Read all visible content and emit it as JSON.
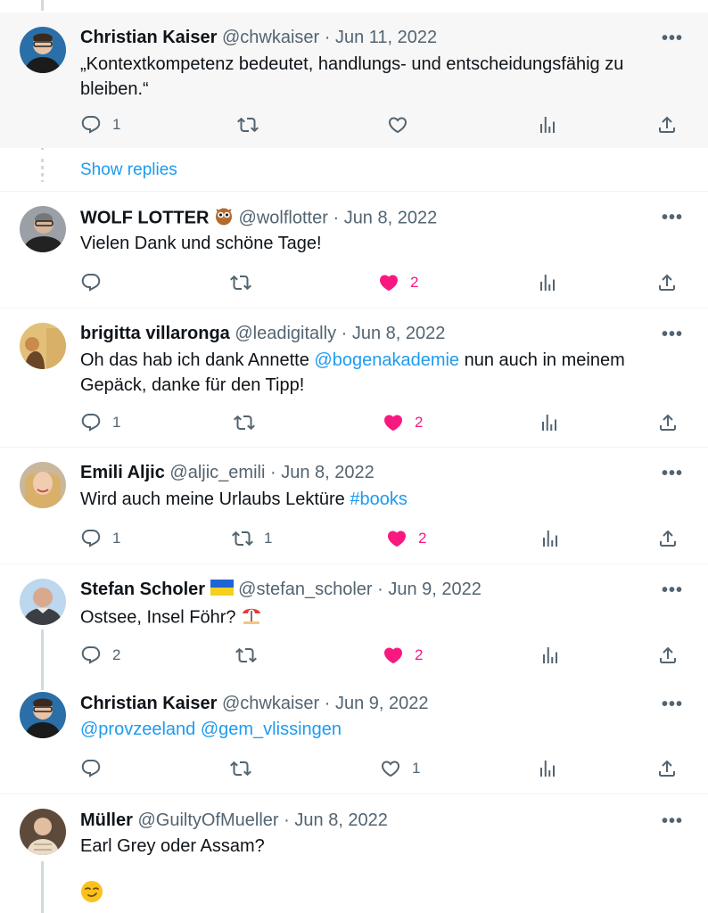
{
  "tweets": [
    {
      "name": "Christian Kaiser",
      "handle": "@chwkaiser",
      "date": "Jun 11, 2022",
      "text": "„Kontextkompetenz bedeutet, handlungs- und entscheidungsfähig zu bleiben.“",
      "replies": "1",
      "retweets": "",
      "likes": "",
      "liked": false
    },
    {
      "name": "WOLF LOTTER",
      "handle": "@wolflotter",
      "date": "Jun 8, 2022",
      "text": "Vielen Dank und schöne Tage!",
      "replies": "",
      "retweets": "",
      "likes": "2",
      "liked": true
    },
    {
      "name": "brigitta villaronga",
      "handle": "@leadigitally",
      "date": "Jun 8, 2022",
      "text_before": "Oh das hab ich dank Annette ",
      "mention": "@bogenakademie",
      "text_after": " nun auch in meinem Gepäck, danke für den Tipp!",
      "replies": "1",
      "retweets": "",
      "likes": "2",
      "liked": true
    },
    {
      "name": "Emili Aljic",
      "handle": "@aljic_emili",
      "date": "Jun 8, 2022",
      "text_before": "Wird auch meine Urlaubs Lektüre ",
      "hashtag": "#books",
      "replies": "1",
      "retweets": "1",
      "likes": "2",
      "liked": true
    },
    {
      "name": "Stefan Scholer",
      "handle": "@stefan_scholer",
      "date": "Jun 9, 2022",
      "text": "Ostsee, Insel Föhr?",
      "replies": "2",
      "retweets": "",
      "likes": "2",
      "liked": true
    },
    {
      "name": "Christian Kaiser",
      "handle": "@chwkaiser",
      "date": "Jun 9, 2022",
      "mention1": "@provzeeland",
      "mention2": "@gem_vlissingen",
      "replies": "",
      "retweets": "",
      "likes": "1",
      "liked": false
    },
    {
      "name": "Müller",
      "handle": "@GuiltyOfMueller",
      "date": "Jun 8, 2022",
      "text": "Earl Grey oder Assam?",
      "emoji_icon": "smirking-face-emoji"
    }
  ],
  "show_replies_label": "Show replies",
  "separator": "·",
  "more_label": "•••",
  "icons": [
    "reply-icon",
    "retweet-icon",
    "like-icon",
    "views-icon",
    "share-icon",
    "owl-emoji",
    "ukraine-flag-emoji",
    "beach-umbrella-emoji"
  ],
  "colors": {
    "accent": "#1d9bf0",
    "like": "#f91880",
    "muted": "#536471"
  }
}
